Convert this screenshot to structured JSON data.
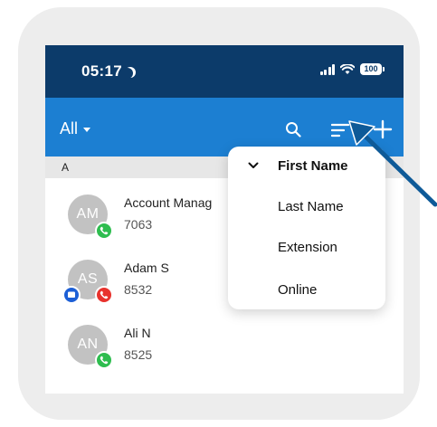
{
  "status_bar": {
    "time": "05:17",
    "battery": "100"
  },
  "app_bar": {
    "filter_label": "All"
  },
  "section_header": "A",
  "contacts": [
    {
      "initials": "AM",
      "name": "Account Manag",
      "extension": "7063",
      "status": "online"
    },
    {
      "initials": "AS",
      "name": "Adam S",
      "extension": "8532",
      "status": "busy"
    },
    {
      "initials": "AN",
      "name": "Ali N",
      "extension": "8525",
      "status": "online"
    }
  ],
  "sort_menu": {
    "items": [
      {
        "label": "First Name",
        "selected": true
      },
      {
        "label": "Last Name",
        "selected": false
      },
      {
        "label": "Extension",
        "selected": false
      },
      {
        "label": "Online",
        "selected": false
      }
    ]
  },
  "colors": {
    "status_bar_bg": "#0c3b6a",
    "app_bar_bg": "#1c7fd2",
    "online_green": "#2ebd4f",
    "busy_red": "#e8322d",
    "chat_blue": "#1c5fd6",
    "avatar_gray": "#c2c2c2",
    "annotation_arrow": "#0e5a98"
  },
  "icons": {
    "moon": "moon-icon",
    "signal": "signal-icon",
    "wifi": "wifi-icon",
    "battery": "battery-icon",
    "search": "search-icon",
    "sort": "sort-icon",
    "add": "add-icon",
    "phone": "phone-icon",
    "chat": "chat-icon",
    "check": "check-icon"
  }
}
